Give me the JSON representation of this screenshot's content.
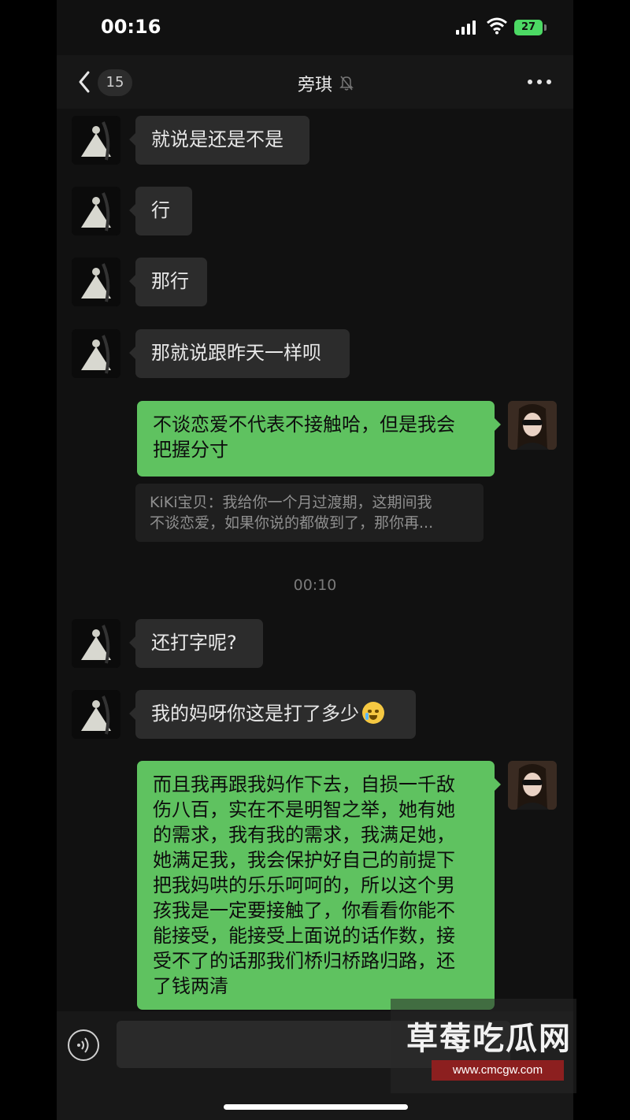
{
  "status_bar": {
    "time": "00:16",
    "battery": "27"
  },
  "nav": {
    "back_count": "15",
    "title": "旁琪"
  },
  "messages": [
    {
      "side": "in",
      "text": "就说是还是不是"
    },
    {
      "side": "in",
      "text": "行"
    },
    {
      "side": "in",
      "text": "那行"
    },
    {
      "side": "in",
      "text": "那就说跟昨天一样呗"
    },
    {
      "side": "out",
      "text": "不谈恋爱不代表不接触哈，但是我会\n把握分寸"
    },
    {
      "side": "quote",
      "text": "KiKi宝贝：我给你一个月过渡期，这期间我\n不谈恋爱，如果你说的都做到了，那你再..."
    },
    {
      "side": "time",
      "text": "00:10"
    },
    {
      "side": "in",
      "text": "还打字呢?"
    },
    {
      "side": "in",
      "text": "我的妈呀你这是打了多少",
      "emoji": "crying-face-emoji"
    },
    {
      "side": "out",
      "text": "而且我再跟我妈作下去，自损一千敌\n伤八百，实在不是明智之举，她有她\n的需求，我有我的需求，我满足她，\n她满足我，我会保护好自己的前提下\n把我妈哄的乐乐呵呵的，所以这个男\n孩我是一定要接触了，你看看你能不\n能接受，能接受上面说的话作数，接\n受不了的话那我们桥归桥路归路，还\n了钱两清"
    }
  ],
  "watermark": {
    "title": "草莓吃瓜网",
    "url": "www.cmcgw.com"
  },
  "colors": {
    "outgoing_bubble": "#5fc260",
    "incoming_bubble": "#2c2c2c",
    "background": "#111111"
  }
}
